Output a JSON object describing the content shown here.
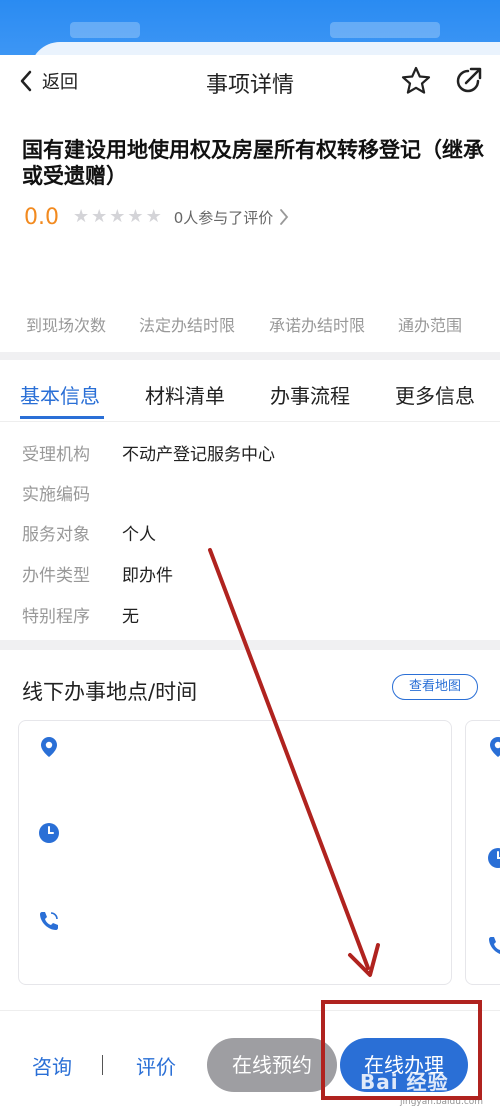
{
  "nav": {
    "back_label": "返回",
    "title": "事项详情"
  },
  "item": {
    "title": "国有建设用地使用权及房屋所有权转移登记（继承或受遗赠）",
    "rating_score": "0.0",
    "rating_count": "0人参与了评价",
    "stars": [
      "★",
      "★",
      "★",
      "★",
      "★"
    ]
  },
  "stats": [
    "到现场次数",
    "法定办结时限",
    "承诺办结时限",
    "通办范围"
  ],
  "tabs": [
    "基本信息",
    "材料清单",
    "办事流程",
    "更多信息"
  ],
  "basic_info": [
    {
      "key": "受理机构",
      "value": "不动产登记服务中心"
    },
    {
      "key": "实施编码",
      "value": ""
    },
    {
      "key": "服务对象",
      "value": "个人"
    },
    {
      "key": "办件类型",
      "value": "即办件"
    },
    {
      "key": "特别程序",
      "value": "无"
    }
  ],
  "location": {
    "title": "线下办事地点/时间",
    "map_button": "查看地图"
  },
  "bottom": {
    "consult": "咨询",
    "review": "评价",
    "appoint": "在线预约",
    "online": "在线办理"
  },
  "watermark": {
    "brand": "Bai 经验",
    "sub": "jingyan.baidu.com"
  },
  "colors": {
    "primary": "#2a6fd6",
    "rating": "#f28a1f",
    "annotation": "#b0231f"
  }
}
